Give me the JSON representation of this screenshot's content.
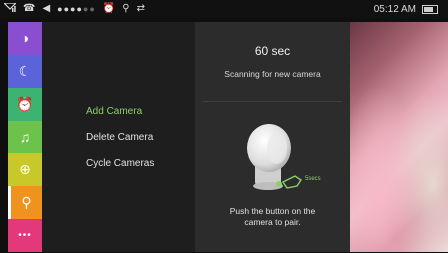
{
  "status_bar": {
    "time": "05:12 AM",
    "icons": [
      "signal-icon",
      "phone-icon",
      "speaker-icon",
      "volume-dots",
      "alarm-icon",
      "location-icon",
      "sync-icon",
      "battery-icon"
    ]
  },
  "sidebar": {
    "items": [
      {
        "name": "night-light",
        "icon": "◑",
        "color": "#8a4fd0"
      },
      {
        "name": "sleep-moon",
        "icon": "☾",
        "color": "#5a63d8"
      },
      {
        "name": "alarm",
        "icon": "⏰",
        "color": "#3cb371"
      },
      {
        "name": "music",
        "icon": "♫",
        "color": "#6cc24a"
      },
      {
        "name": "zoom",
        "icon": "⊕",
        "color": "#c8c82a"
      },
      {
        "name": "camera-location",
        "icon": "⚲",
        "color": "#f0921e",
        "active": true
      },
      {
        "name": "more",
        "icon": "•••",
        "color": "#e3397a"
      }
    ]
  },
  "menu": {
    "items": [
      {
        "label": "Add Camera",
        "selected": true
      },
      {
        "label": "Delete Camera",
        "selected": false
      },
      {
        "label": "Cycle Cameras",
        "selected": false
      }
    ]
  },
  "info": {
    "timer": "60 sec",
    "scan_text": "Scanning for new camera",
    "push_text_line1": "Push the button on the",
    "push_text_line2": "camera to pair.",
    "camera_label": "5secs",
    "accent_color": "#8bd16a"
  }
}
